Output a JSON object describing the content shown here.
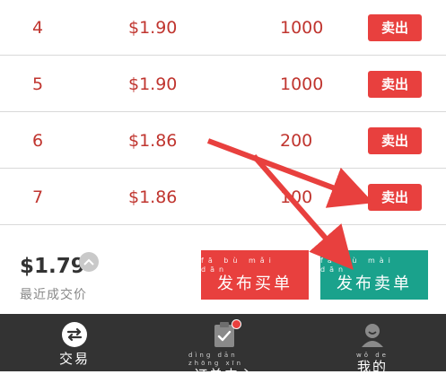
{
  "orders": [
    {
      "index": "4",
      "price": "$1.90",
      "quantity": "1000",
      "action": "卖出"
    },
    {
      "index": "5",
      "price": "$1.90",
      "quantity": "1000",
      "action": "卖出"
    },
    {
      "index": "6",
      "price": "$1.86",
      "quantity": "200",
      "action": "卖出"
    },
    {
      "index": "7",
      "price": "$1.86",
      "quantity": "100",
      "action": "卖出"
    }
  ],
  "summary": {
    "last_price": "$1.79",
    "last_price_label": "最近成交价",
    "toggle_icon": "chevron-up-icon"
  },
  "actions": {
    "buy": {
      "pinyin": "fā bù mǎi dān",
      "label": "发布买单",
      "color": "#e8403e"
    },
    "sell": {
      "pinyin": "fā bù mài dān",
      "label": "发布卖单",
      "color": "#1aa28c"
    }
  },
  "tabs": [
    {
      "pinyin": "",
      "label": "交易",
      "icon": "swap-icon"
    },
    {
      "pinyin": "dìng dān zhōng xīn",
      "label": "订单中心",
      "icon": "clipboard-check-icon"
    },
    {
      "pinyin": "wǒ de",
      "label": "我的",
      "icon": "profile-icon"
    }
  ],
  "colors": {
    "accent_red": "#e8403e",
    "accent_teal": "#1aa28c",
    "tabbar_bg": "#333333",
    "annotation_arrow": "#e8403e"
  }
}
